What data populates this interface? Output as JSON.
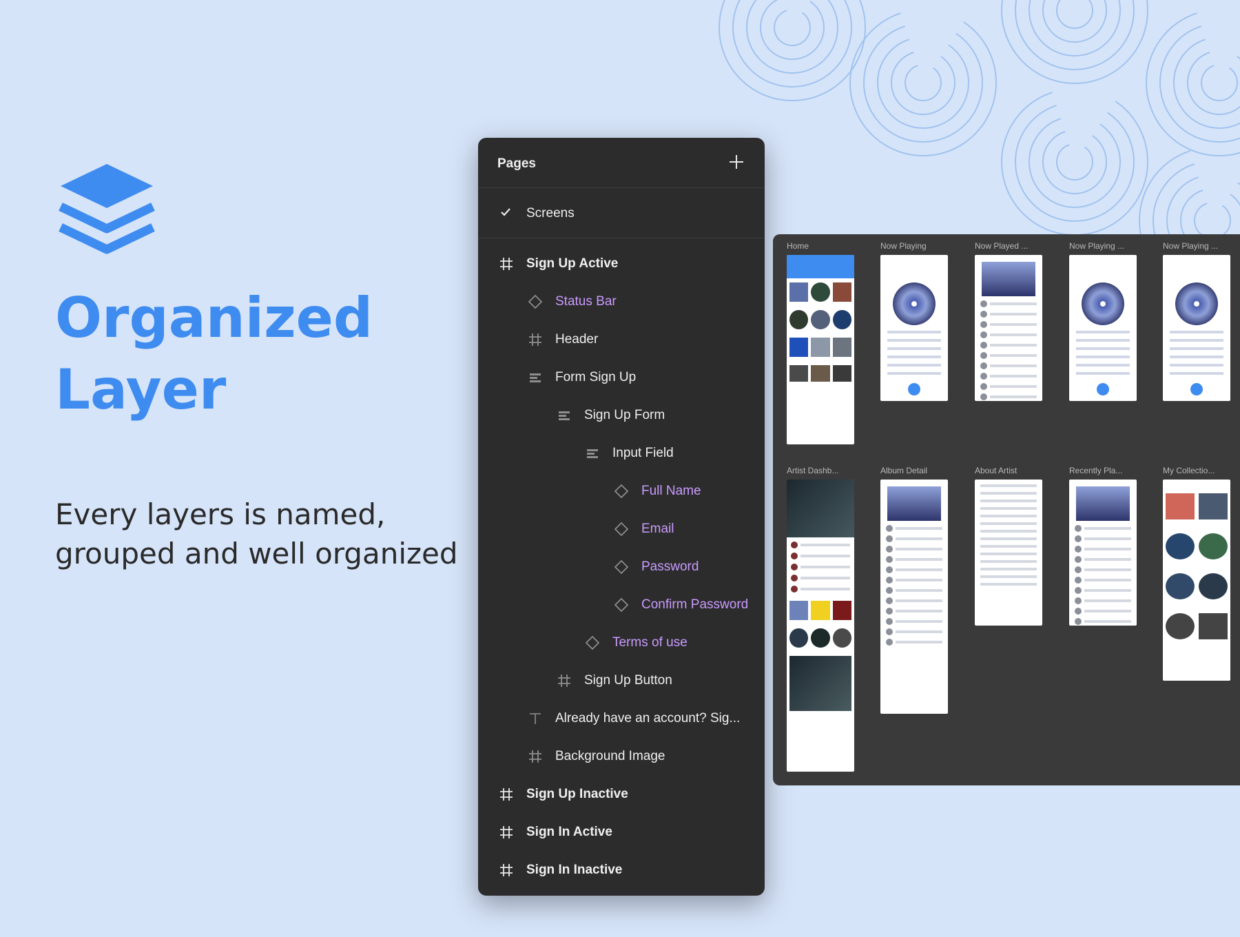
{
  "headline": {
    "line1": "Organized",
    "line2": "Layer"
  },
  "subtitle": {
    "line1": "Every layers is named,",
    "line2": "grouped and well organized"
  },
  "colors": {
    "accent": "#3f8cf0",
    "panel": "#2c2c2c",
    "component": "#c99bff",
    "background": "#d6e4f9"
  },
  "panel": {
    "title": "Pages",
    "add_icon": "plus-icon",
    "current_page": "Screens",
    "layers": [
      {
        "label": "Sign Up Active",
        "icon": "frame-icon",
        "kind": "top"
      },
      {
        "label": "Status Bar",
        "icon": "component-instance-icon",
        "kind": "comp"
      },
      {
        "label": "Header",
        "icon": "frame-icon",
        "kind": "plain"
      },
      {
        "label": "Form Sign Up",
        "icon": "auto-layout-icon",
        "kind": "plain"
      },
      {
        "label": "Sign Up Form",
        "icon": "auto-layout-icon",
        "kind": "plain"
      },
      {
        "label": "Input Field",
        "icon": "auto-layout-icon",
        "kind": "plain"
      },
      {
        "label": "Full Name",
        "icon": "component-instance-icon",
        "kind": "comp"
      },
      {
        "label": "Email",
        "icon": "component-instance-icon",
        "kind": "comp"
      },
      {
        "label": "Password",
        "icon": "component-instance-icon",
        "kind": "comp"
      },
      {
        "label": "Confirm Password",
        "icon": "component-instance-icon",
        "kind": "comp"
      },
      {
        "label": "Terms of use",
        "icon": "component-instance-icon",
        "kind": "comp"
      },
      {
        "label": "Sign Up Button",
        "icon": "frame-icon",
        "kind": "plain"
      },
      {
        "label": "Already have an account? Sig...",
        "icon": "text-icon",
        "kind": "plain"
      },
      {
        "label": "Background Image",
        "icon": "frame-icon",
        "kind": "plain"
      },
      {
        "label": "Sign Up Inactive",
        "icon": "frame-icon",
        "kind": "top"
      },
      {
        "label": "Sign In Active",
        "icon": "frame-icon",
        "kind": "top"
      },
      {
        "label": "Sign In Inactive",
        "icon": "frame-icon",
        "kind": "top"
      }
    ]
  },
  "canvas": {
    "frames_row1": [
      "Home",
      "Now Playing",
      "Now Played ...",
      "Now Playing ...",
      "Now Playing ..."
    ],
    "frames_row2": [
      "Artist Dashb...",
      "Album Detail",
      "About Artist",
      "Recently Pla...",
      "My Collectio..."
    ]
  }
}
